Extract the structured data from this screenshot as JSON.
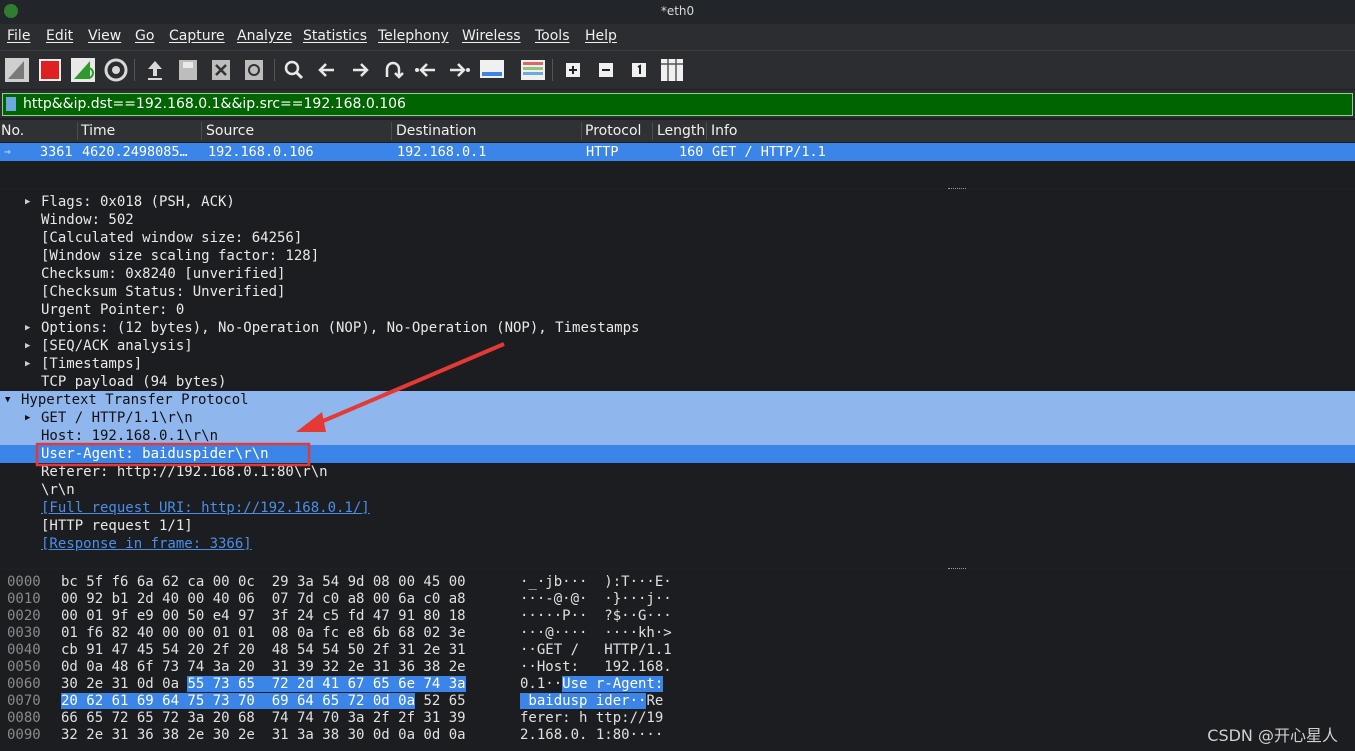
{
  "window": {
    "title": "*eth0"
  },
  "menu": [
    "File",
    "Edit",
    "View",
    "Go",
    "Capture",
    "Analyze",
    "Statistics",
    "Telephony",
    "Wireless",
    "Tools",
    "Help"
  ],
  "toolbar": {
    "icons": [
      "shark-fin-start-icon",
      "stop-capture-icon",
      "restart-capture-icon",
      "capture-options-icon",
      "open-file-icon",
      "save-file-icon",
      "close-file-icon",
      "reload-file-icon",
      "find-packet-icon",
      "go-back-icon",
      "go-forward-icon",
      "go-to-packet-icon",
      "previous-packet-icon",
      "next-packet-icon",
      "auto-scroll-icon",
      "colorize-icon",
      "zoom-in-icon",
      "zoom-out-icon",
      "normal-size-icon",
      "resize-columns-icon"
    ]
  },
  "filter": {
    "value": "http&&ip.dst==192.168.0.1&&ip.src==192.168.0.106"
  },
  "packet_list": {
    "columns": [
      "No.",
      "Time",
      "Source",
      "Destination",
      "Protocol",
      "Length",
      "Info"
    ],
    "rows": [
      {
        "no": "3361",
        "time": "4620.2498085…",
        "source": "192.168.0.106",
        "destination": "192.168.0.1",
        "protocol": "HTTP",
        "length": "160",
        "info": "GET / HTTP/1.1"
      }
    ]
  },
  "details": {
    "flags": "Flags: 0x018 (PSH, ACK)",
    "window": "Window: 502",
    "calc_window": "[Calculated window size: 64256]",
    "scaling": "[Window size scaling factor: 128]",
    "checksum": "Checksum: 0x8240 [unverified]",
    "checksum_status": "[Checksum Status: Unverified]",
    "urgent": "Urgent Pointer: 0",
    "options": "Options: (12 bytes), No-Operation (NOP), No-Operation (NOP), Timestamps",
    "seqack": "[SEQ/ACK analysis]",
    "timestamps": "[Timestamps]",
    "payload": "TCP payload (94 bytes)",
    "http": "Hypertext Transfer Protocol",
    "get": "GET / HTTP/1.1\\r\\n",
    "host": "Host: 192.168.0.1\\r\\n",
    "ua": "User-Agent: baiduspider\\r\\n",
    "referer": "Referer: http://192.168.0.1:80\\r\\n",
    "crlf": "\\r\\n",
    "full_uri": "[Full request URI: http://192.168.0.1/]",
    "request": "[HTTP request 1/1]",
    "response": "[Response in frame: 3366]"
  },
  "hex": [
    {
      "off": "0000",
      "pre": "bc 5f f6 6a 62 ca 00 0c  29 3a 54 9d 08 00 45 00",
      "hl": "",
      "post": "",
      "apre": "·_·jb···  ):T···E·",
      "ahl": "",
      "apost": ""
    },
    {
      "off": "0010",
      "pre": "00 92 b1 2d 40 00 40 06  07 7d c0 a8 00 6a c0 a8",
      "hl": "",
      "post": "",
      "apre": "···-@·@·  ·}···j··",
      "ahl": "",
      "apost": ""
    },
    {
      "off": "0020",
      "pre": "00 01 9f e9 00 50 e4 97  3f 24 c5 fd 47 91 80 18",
      "hl": "",
      "post": "",
      "apre": "·····P··  ?$··G···",
      "ahl": "",
      "apost": ""
    },
    {
      "off": "0030",
      "pre": "01 f6 82 40 00 00 01 01  08 0a fc e8 6b 68 02 3e",
      "hl": "",
      "post": "",
      "apre": "···@····  ····kh·>",
      "ahl": "",
      "apost": ""
    },
    {
      "off": "0040",
      "pre": "cb 91 47 45 54 20 2f 20  48 54 54 50 2f 31 2e 31",
      "hl": "",
      "post": "",
      "apre": "··GET /   HTTP/1.1",
      "ahl": "",
      "apost": ""
    },
    {
      "off": "0050",
      "pre": "0d 0a 48 6f 73 74 3a 20  31 39 32 2e 31 36 38 2e",
      "hl": "",
      "post": "",
      "apre": "··Host:   192.168.",
      "ahl": "",
      "apost": ""
    },
    {
      "off": "0060",
      "pre": "30 2e 31 0d 0a ",
      "hl": "55 73 65  72 2d 41 67 65 6e 74 3a",
      "post": "",
      "apre": "0.1··",
      "ahl": "Use r-Agent:",
      "apost": ""
    },
    {
      "off": "0070",
      "pre": "",
      "hl": "20 62 61 69 64 75 73 70  69 64 65 72 0d 0a",
      "post": " 52 65",
      "apre": "",
      "ahl": " baidusp ider··",
      "apost": "Re"
    },
    {
      "off": "0080",
      "pre": "66 65 72 65 72 3a 20 68  74 74 70 3a 2f 2f 31 39",
      "hl": "",
      "post": "",
      "apre": "ferer: h ttp://19",
      "ahl": "",
      "apost": ""
    },
    {
      "off": "0090",
      "pre": "32 2e 31 36 38 2e 30 2e  31 3a 38 30 0d 0a 0d 0a",
      "hl": "",
      "post": "",
      "apre": "2.168.0. 1:80····",
      "ahl": "",
      "apost": ""
    }
  ],
  "watermark": "CSDN @开心星人"
}
